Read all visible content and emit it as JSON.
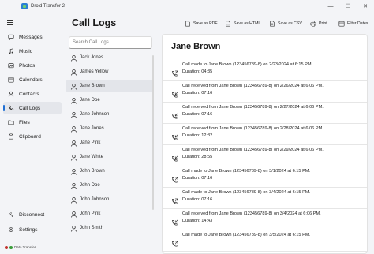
{
  "app": {
    "title": "Droid Transfer 2"
  },
  "window": {
    "minimize": "—",
    "maximize": "☐",
    "close": "✕"
  },
  "nav": {
    "items": [
      {
        "label": "Messages",
        "icon": "message-icon"
      },
      {
        "label": "Music",
        "icon": "music-icon"
      },
      {
        "label": "Photos",
        "icon": "photo-icon"
      },
      {
        "label": "Calendars",
        "icon": "calendar-icon"
      },
      {
        "label": "Contacts",
        "icon": "contacts-icon"
      },
      {
        "label": "Call Logs",
        "icon": "phone-icon",
        "active": true
      },
      {
        "label": "Files",
        "icon": "folder-icon"
      },
      {
        "label": "Clipboard",
        "icon": "clipboard-icon"
      }
    ],
    "disconnect": "Disconnect",
    "settings": "Settings"
  },
  "status": {
    "text": "Data Transfer",
    "colors": [
      "#c0302b",
      "#3a9d3a"
    ]
  },
  "page": {
    "title": "Call Logs"
  },
  "toolbar": {
    "save_pdf": "Save as PDF",
    "save_html": "Save as HTML",
    "save_csv": "Save as CSV",
    "print": "Print",
    "filter": "Filter Dates"
  },
  "search": {
    "placeholder": "Search Call Logs"
  },
  "contacts": [
    "Jack Jones",
    "James Yellow",
    "Jane Brown",
    "Jane Doe",
    "Jane Johnson",
    "Jane Jones",
    "Jane Pink",
    "Jane White",
    "John Brown",
    "John Doe",
    "John Johnson",
    "John Pink",
    "John Smith"
  ],
  "selected_contact": "Jane Brown",
  "detail": {
    "name": "Jane Brown",
    "calls": [
      {
        "type": "made",
        "text": "Call made to Jane Brown (123456789-8) on 2/23/2024 at 6:15 PM.",
        "duration": "Duration: 04:35"
      },
      {
        "type": "received",
        "text": "Call received from Jane Brown (123456789-8) on 2/26/2024 at 6:06 PM.",
        "duration": "Duration: 07:16"
      },
      {
        "type": "received",
        "text": "Call received from Jane Brown (123456789-8) on 2/27/2024 at 6:06 PM.",
        "duration": "Duration: 07:16"
      },
      {
        "type": "received",
        "text": "Call received from Jane Brown (123456789-8) on 2/28/2024 at 6:06 PM.",
        "duration": "Duration: 12:32"
      },
      {
        "type": "received",
        "text": "Call received from Jane Brown (123456789-8) on 2/29/2024 at 6:06 PM.",
        "duration": "Duration: 28:55"
      },
      {
        "type": "made",
        "text": "Call made to Jane Brown (123456789-8) on 3/1/2024 at 6:15 PM.",
        "duration": "Duration: 07:16"
      },
      {
        "type": "made",
        "text": "Call made to Jane Brown (123456789-8) on 3/4/2024 at 6:15 PM.",
        "duration": "Duration: 07:16"
      },
      {
        "type": "received",
        "text": "Call received from Jane Brown (123456789-8) on 3/4/2024 at 6:06 PM.",
        "duration": "Duration: 14:43"
      },
      {
        "type": "made",
        "text": "Call made to Jane Brown (123456789-8) on 3/5/2024 at 6:15 PM.",
        "duration": ""
      }
    ]
  },
  "accent_color": "#1f6fd4"
}
